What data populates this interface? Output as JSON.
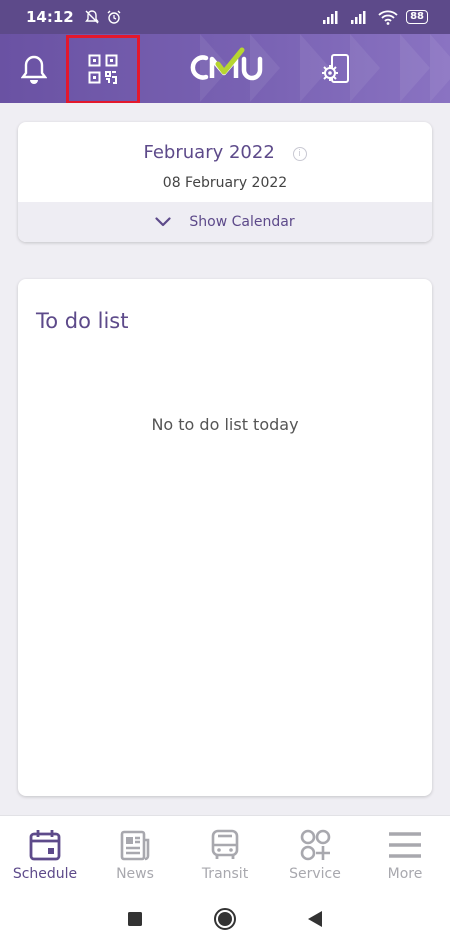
{
  "status_bar": {
    "time": "14:12",
    "battery": "88"
  },
  "header": {
    "logo_text": "CMU",
    "icons": [
      "bell-icon",
      "qr-code-icon",
      "settings-device-icon"
    ],
    "accent": "#6a52a3",
    "highlight_color": "#e3182d"
  },
  "calendar": {
    "month": "February 2022",
    "date": "08 February 2022",
    "toggle_label": "Show Calendar"
  },
  "todo": {
    "title": "To do list",
    "empty_message": "No to do list today"
  },
  "bottom_nav": {
    "items": [
      {
        "label": "Schedule",
        "icon": "calendar-icon",
        "active": true
      },
      {
        "label": "News",
        "icon": "newspaper-icon",
        "active": false
      },
      {
        "label": "Transit",
        "icon": "bus-icon",
        "active": false
      },
      {
        "label": "Service",
        "icon": "service-grid-icon",
        "active": false
      },
      {
        "label": "More",
        "icon": "menu-icon",
        "active": false
      }
    ]
  },
  "system_nav": [
    "recents-square-icon",
    "home-circle-icon",
    "back-triangle-icon"
  ]
}
